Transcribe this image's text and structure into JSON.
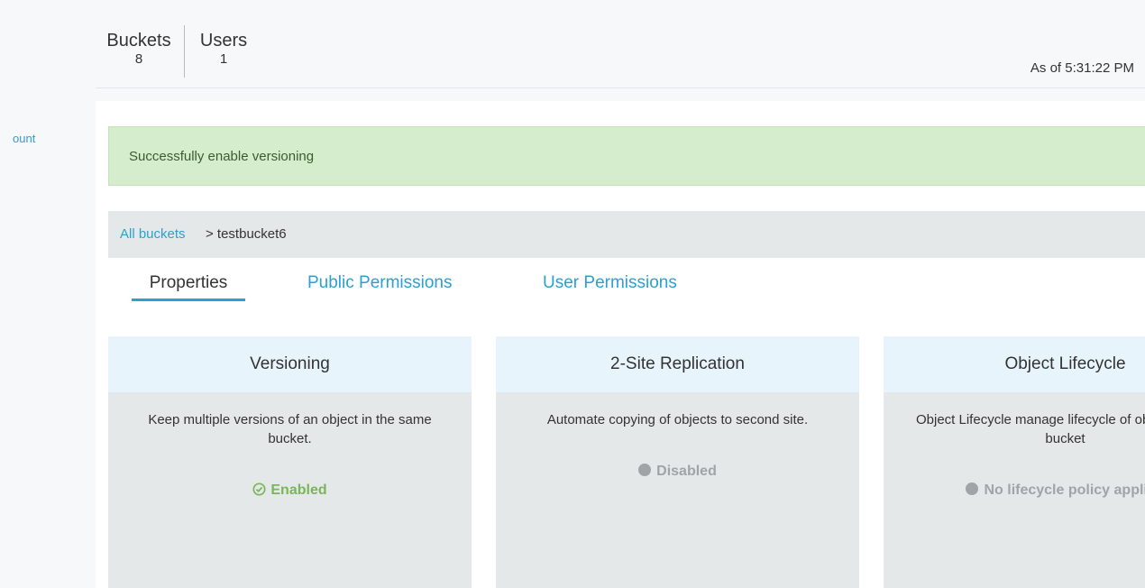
{
  "left_rail": {
    "link_fragment": "ount"
  },
  "stats": {
    "buckets_label": "Buckets",
    "buckets_value": "8",
    "users_label": "Users",
    "users_value": "1",
    "as_of": "As of 5:31:22 PM"
  },
  "alert": {
    "message": "Successfully enable versioning",
    "color": "#d5edcd"
  },
  "breadcrumb": {
    "link": "All buckets",
    "rest": " > testbucket6"
  },
  "tabs": [
    {
      "label": "Properties",
      "active": true
    },
    {
      "label": "Public Permissions",
      "active": false
    },
    {
      "label": "User Permissions",
      "active": false
    }
  ],
  "cards": [
    {
      "title": "Versioning",
      "description": "Keep multiple versions of an object in the same bucket.",
      "status": "Enabled",
      "status_icon": "check-circle-icon",
      "status_color": "#7ab55c"
    },
    {
      "title": "2-Site Replication",
      "description": "Automate copying of objects to second site.",
      "status": "Disabled",
      "status_icon": "dot-icon",
      "status_color": "#a0a4a7"
    },
    {
      "title": "Object Lifecycle",
      "description": "Object Lifecycle manage lifecycle of objects in the bucket",
      "status": "No lifecycle policy applied",
      "status_icon": "dot-icon",
      "status_color": "#a0a4a7"
    }
  ],
  "colors": {
    "accent": "#2aa1d1",
    "card_header": "#e8f4fc",
    "card_body": "#e5e8e9"
  }
}
